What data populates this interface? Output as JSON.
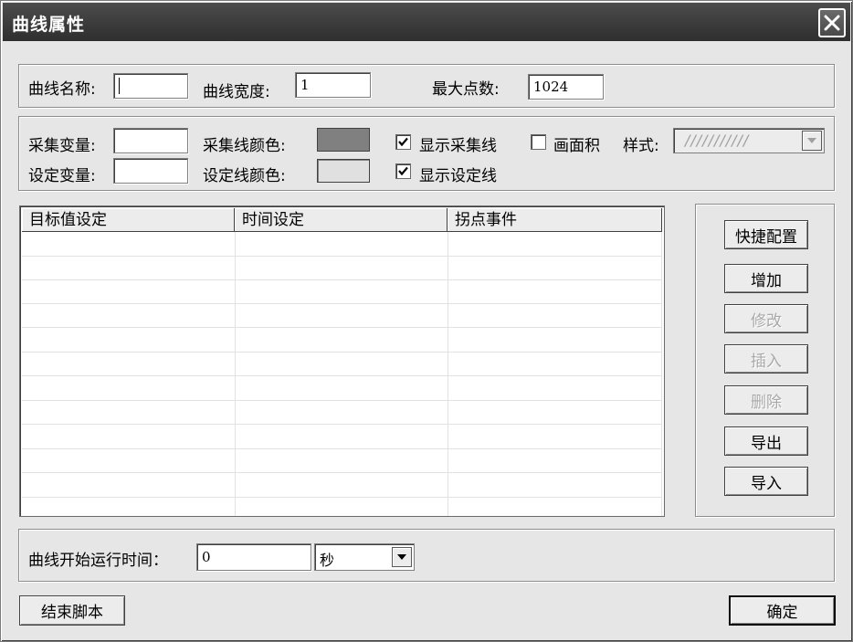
{
  "window": {
    "title": "曲线属性",
    "close_icon": "close-icon"
  },
  "curve_group": {
    "name_label": "曲线名称:",
    "name_value": "",
    "width_label": "曲线宽度:",
    "width_value": "1",
    "max_points_label": "最大点数:",
    "max_points_value": "1024"
  },
  "variable_group": {
    "collect_var_label": "采集变量:",
    "collect_var_value": "",
    "collect_color_label": "采集线颜色:",
    "collect_color": "#808080",
    "show_collect_label": "显示采集线",
    "show_collect_checked": true,
    "draw_area_label": "画面积",
    "draw_area_checked": false,
    "style_label": "样式:",
    "style_value": "///////////",
    "set_var_label": "设定变量:",
    "set_var_value": "",
    "set_color_label": "设定线颜色:",
    "set_color": "#e0e0e0",
    "show_set_label": "显示设定线",
    "show_set_checked": true
  },
  "table": {
    "columns": [
      "目标值设定",
      "时间设定",
      "拐点事件"
    ],
    "rows": [
      [
        "",
        "",
        ""
      ],
      [
        "",
        "",
        ""
      ],
      [
        "",
        "",
        ""
      ],
      [
        "",
        "",
        ""
      ],
      [
        "",
        "",
        ""
      ],
      [
        "",
        "",
        ""
      ],
      [
        "",
        "",
        ""
      ],
      [
        "",
        "",
        ""
      ],
      [
        "",
        "",
        ""
      ],
      [
        "",
        "",
        ""
      ],
      [
        "",
        "",
        ""
      ],
      [
        "",
        "",
        ""
      ]
    ]
  },
  "side_buttons": {
    "quick_config": "快捷配置",
    "add": "增加",
    "modify": "修改",
    "insert": "插入",
    "delete": "删除",
    "export": "导出",
    "import": "导入"
  },
  "start_time": {
    "label": "曲线开始运行时间：",
    "value": "0",
    "unit": "秒"
  },
  "footer": {
    "end_script": "结束脚本",
    "ok": "确定"
  }
}
